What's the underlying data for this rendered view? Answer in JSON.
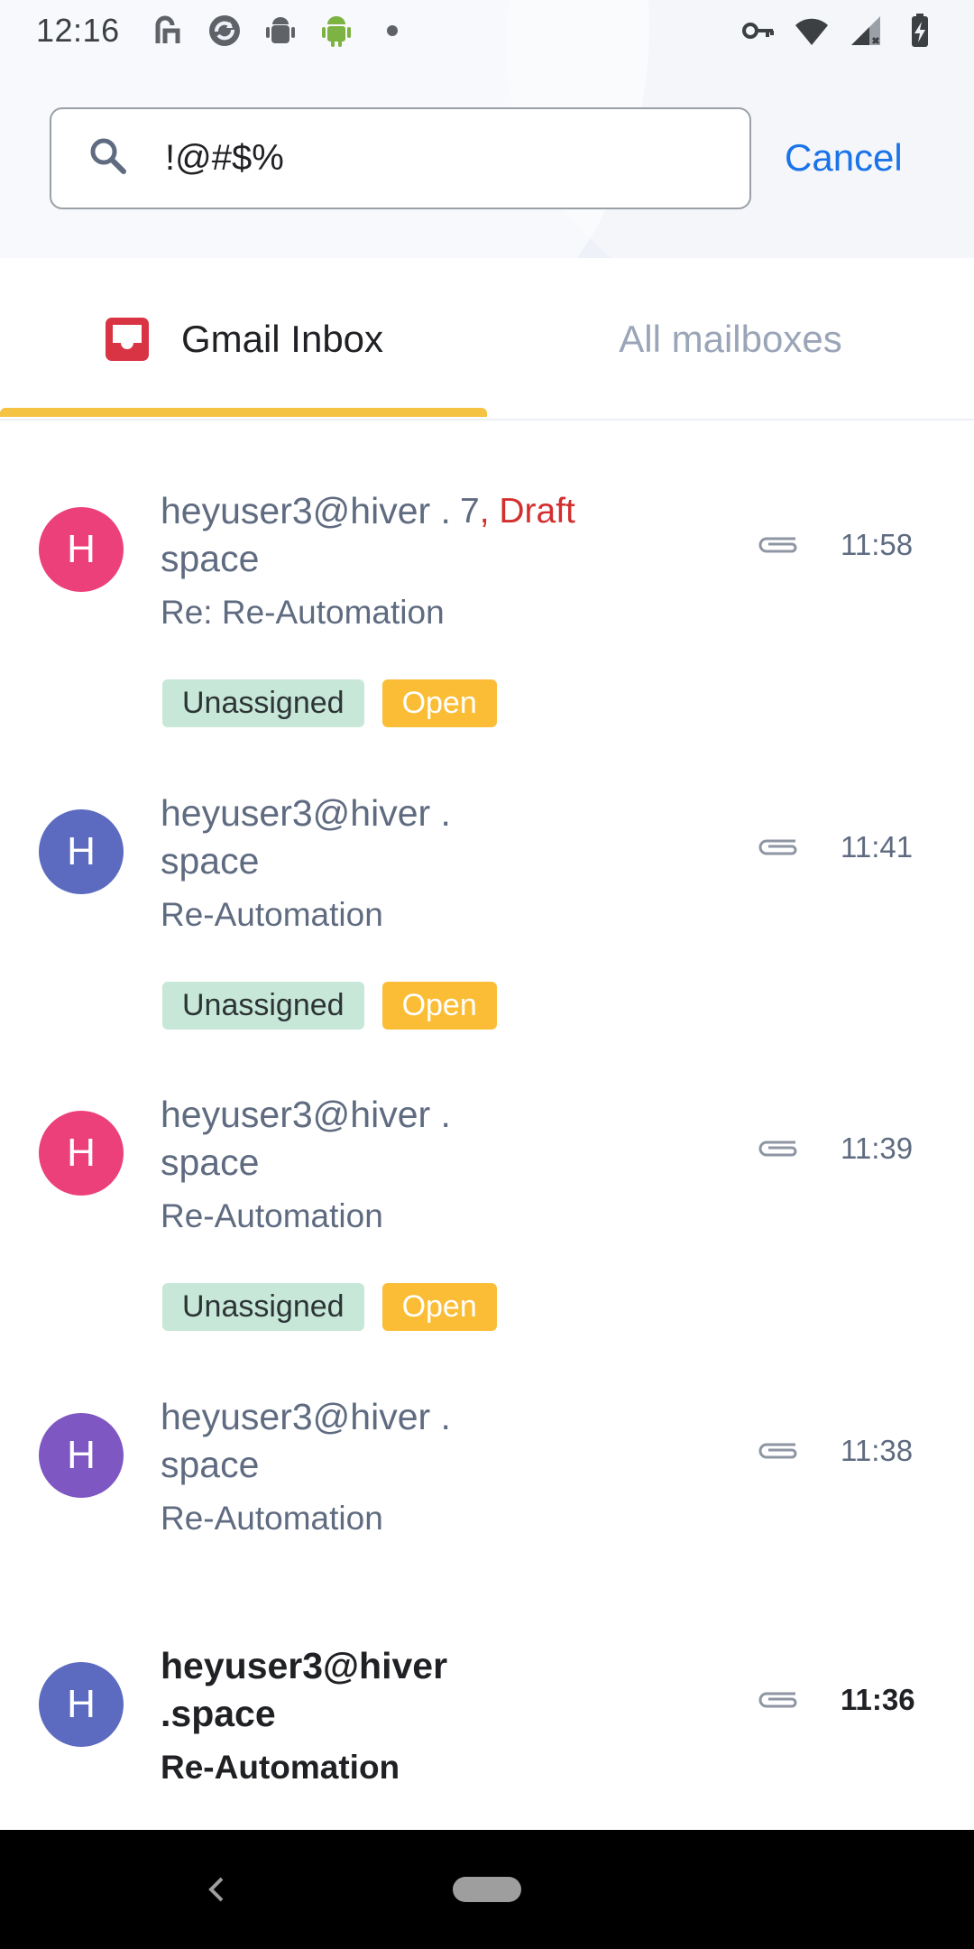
{
  "status_bar": {
    "time": "12:16",
    "left_icons": [
      "hiver-icon",
      "sync-icon",
      "android-debug-icon",
      "android-icon",
      "dot-icon"
    ],
    "right_icons": [
      "vpn-key-icon",
      "wifi-icon",
      "signal-icon",
      "battery-charging-icon"
    ]
  },
  "search": {
    "value": "!@#$%",
    "placeholder": "",
    "cancel_label": "Cancel"
  },
  "tabs": [
    {
      "label": "Gmail Inbox",
      "icon": "inbox-icon",
      "active": true
    },
    {
      "label": "All mailboxes",
      "active": false
    }
  ],
  "colors": {
    "accent": "#1a73e8",
    "tab_indicator": "#f5c342",
    "draft": "#d32f2f",
    "tag_unassigned": "#c7e7d8",
    "tag_open": "#fbbd35",
    "avatar_pink": "#ec407a",
    "avatar_indigo": "#5c6bc0",
    "avatar_purple": "#7e57c2"
  },
  "mails": [
    {
      "avatar_letter": "H",
      "avatar_color": "#ec407a",
      "sender": "heyuser3@hiver .space",
      "count": "7",
      "draft_label": "Draft",
      "subject": "Re: Re-Automation",
      "time": "11:58",
      "has_attachment": true,
      "tags": [
        "Unassigned",
        "Open"
      ],
      "unread": false
    },
    {
      "avatar_letter": "H",
      "avatar_color": "#5c6bc0",
      "sender": "heyuser3@hiver .space",
      "subject": "Re-Automation",
      "time": "11:41",
      "has_attachment": true,
      "tags": [
        "Unassigned",
        "Open"
      ],
      "unread": false
    },
    {
      "avatar_letter": "H",
      "avatar_color": "#ec407a",
      "sender": "heyuser3@hiver .space",
      "subject": "Re-Automation",
      "time": "11:39",
      "has_attachment": true,
      "tags": [
        "Unassigned",
        "Open"
      ],
      "unread": false
    },
    {
      "avatar_letter": "H",
      "avatar_color": "#7e57c2",
      "sender": "heyuser3@hiver .space",
      "subject": "Re-Automation",
      "time": "11:38",
      "has_attachment": true,
      "tags": [],
      "unread": false
    },
    {
      "avatar_letter": "H",
      "avatar_color": "#5c6bc0",
      "sender": "heyuser3@hiver .space",
      "subject": "Re-Automation",
      "time": "11:36",
      "has_attachment": true,
      "tags": [],
      "unread": true
    }
  ],
  "nav_bar": {
    "buttons": [
      "back-button",
      "home-button"
    ]
  }
}
